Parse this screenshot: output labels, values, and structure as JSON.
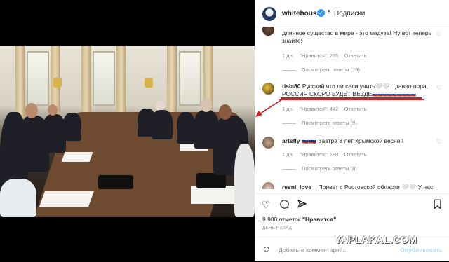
{
  "header": {
    "username": "whitehouse",
    "verified_mark": "✓",
    "separator": "•",
    "follow_label": "Подписки"
  },
  "comments": [
    {
      "user": "",
      "text": "длинное существо в мире - это медуза! Ну вот теперь знайте!",
      "time": "1 дн.",
      "likes": "\"Нравится\": 235",
      "reply": "Ответить",
      "view_replies": "Посмотреть ответы (18)"
    },
    {
      "user": "tisla80",
      "text": "Русский что ли сели учить🤍🤍...давно пора, РОССИЯ СКОРО БУДЕТ ВЕЗДЕ",
      "tail": "🇷🇺🇷🇺🇷🇺🇷🇺🇷🇺🇷🇺🇷🇺🇷🇺🇷🇺",
      "time": "1 дн.",
      "likes": "\"Нравится\": 442",
      "reply": "Ответить",
      "view_replies": "Посмотреть ответы (9)"
    },
    {
      "user": "artsfly",
      "text": "🇷🇺🇷🇺 Завтра 8 лет Крымской весне !",
      "time": "1 дн.",
      "likes": "\"Нравится\": 180",
      "reply": "Ответить",
      "view_replies": "Посмотреть ответы (8)"
    },
    {
      "user": "resni_love_",
      "text": "Привет с Ростовской области 🤍🤍 У нас снег"
    }
  ],
  "actions": {
    "heart_icon": "heart-icon",
    "comment_icon": "comment-icon",
    "share_icon": "share-icon",
    "bookmark_icon": "bookmark-icon"
  },
  "likes": {
    "count": "9 980 отметок",
    "label": "\"Нравится\""
  },
  "time_ago": "ДЕНЬ НАЗАД",
  "add_comment": {
    "placeholder": "Добавьте комментарий...",
    "post_label": "Опубликовать"
  },
  "watermark": "YAPLAKAL.COM",
  "colors": {
    "accent": "#3897f0",
    "annotation": "#d12020"
  }
}
